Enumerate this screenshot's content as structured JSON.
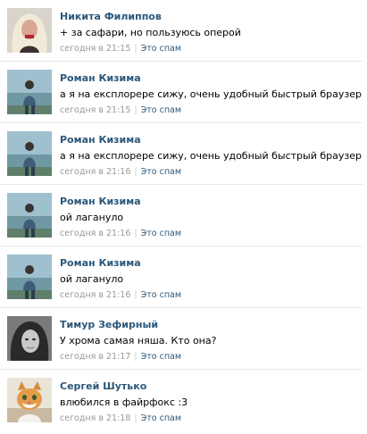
{
  "comments": [
    {
      "author": "Никита Филиппов",
      "text": "+ за сафари, но пользуюсь оперой",
      "time": "сегодня в 21:15",
      "spam_label": "Это спам",
      "avatar": "blonde-wig"
    },
    {
      "author": "Роман Кизима",
      "text": "а я на експлорере сижу, очень удобный быстрый браузер",
      "time": "сегодня в 21:15",
      "spam_label": "Это спам",
      "avatar": "seaside"
    },
    {
      "author": "Роман Кизима",
      "text": "а я на експлорере сижу, очень удобный быстрый браузер",
      "time": "сегодня в 21:16",
      "spam_label": "Это спам",
      "avatar": "seaside"
    },
    {
      "author": "Роман Кизима",
      "text": "ой лагануло",
      "time": "сегодня в 21:16",
      "spam_label": "Это спам",
      "avatar": "seaside"
    },
    {
      "author": "Роман Кизима",
      "text": "ой лагануло",
      "time": "сегодня в 21:16",
      "spam_label": "Это спам",
      "avatar": "seaside"
    },
    {
      "author": "Тимур Зефирный",
      "text": "У хрома самая няша. Кто она?",
      "time": "сегодня в 21:17",
      "spam_label": "Это спам",
      "avatar": "grayscale-portrait"
    },
    {
      "author": "Сергей Шутько",
      "text": "влюбился в файрфокс :3",
      "time": "сегодня в 21:18",
      "spam_label": "Это спам",
      "avatar": "cat"
    }
  ],
  "colors": {
    "author": "#2b587a",
    "meta": "#999999",
    "divider": "#e4e8ed"
  }
}
